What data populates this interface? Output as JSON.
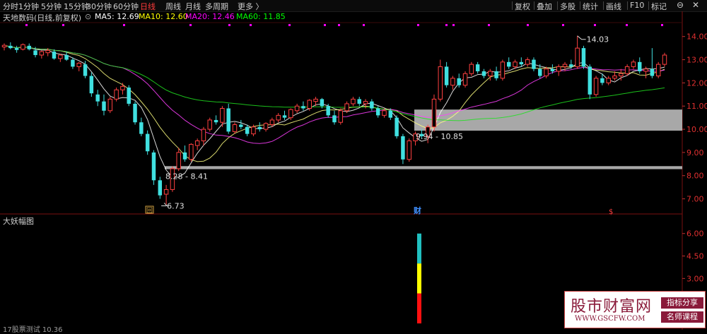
{
  "toolbar": {
    "periods": [
      {
        "label": "分时",
        "active": false
      },
      {
        "label": "1分钟",
        "active": false
      },
      {
        "label": "5分钟",
        "active": false
      },
      {
        "label": "15分钟",
        "active": false
      },
      {
        "label": "30分钟",
        "active": false
      },
      {
        "label": "60分钟",
        "active": false
      },
      {
        "label": "日线",
        "active": true
      },
      {
        "label": "周线",
        "active": false
      },
      {
        "label": "月线",
        "active": false
      },
      {
        "label": "多周期",
        "active": false
      },
      {
        "label": "更多 〉",
        "active": false
      }
    ],
    "right_buttons": [
      "复权",
      "叠加",
      "多股",
      "统计",
      "画线",
      "F10",
      "标记"
    ],
    "window_buttons": [
      "⊖",
      "✕"
    ]
  },
  "infobar": {
    "title": "天地数码(日线,前复权)",
    "ma5": "MA5: 12.69",
    "ma10": "MA10: 12.60",
    "ma20": "MA20: 12.46",
    "ma60": "MA60: 11.85",
    "colors": {
      "ma5": "#ffffff",
      "ma10": "#ffff00",
      "ma20": "#ff00ff",
      "ma60": "#00ff00"
    }
  },
  "annotations": {
    "high": "14.03",
    "low": "6.73",
    "zone_low": "8.28 - 8.41",
    "zone_high": "9.94 - 10.85",
    "fin_marker": "财",
    "buy_marker": "回"
  },
  "price_axis": [
    "14.00",
    "13.00",
    "12.00",
    "11.00",
    "10.00",
    "9.00",
    "8.00",
    "7.00"
  ],
  "sub_axis": [
    "6.00",
    "4.50",
    "3.00"
  ],
  "sub_panel": {
    "title": "大妖幅图"
  },
  "bottom_text": "17股票测试  10.36",
  "watermark": {
    "big": "股市财富网",
    "url": "WWW.GSCFW.COM",
    "tag1": "指标分享",
    "tag2": "名师课程"
  },
  "chart_data": {
    "type": "candlestick",
    "y_range": [
      6.5,
      14.6
    ],
    "candles": [
      [
        13.55,
        13.7,
        13.4,
        13.62
      ],
      [
        13.6,
        13.75,
        13.45,
        13.5
      ],
      [
        13.5,
        13.6,
        13.3,
        13.42
      ],
      [
        13.45,
        13.7,
        13.4,
        13.65
      ],
      [
        13.6,
        13.7,
        13.4,
        13.45
      ],
      [
        13.4,
        13.55,
        13.1,
        13.2
      ],
      [
        13.2,
        13.4,
        13.05,
        13.35
      ],
      [
        13.3,
        13.5,
        13.15,
        13.4
      ],
      [
        13.35,
        13.45,
        13.0,
        13.05
      ],
      [
        13.05,
        13.25,
        12.9,
        13.2
      ],
      [
        13.2,
        13.35,
        12.95,
        13.0
      ],
      [
        13.0,
        13.1,
        12.6,
        12.7
      ],
      [
        12.7,
        12.9,
        12.5,
        12.85
      ],
      [
        12.8,
        12.95,
        12.2,
        12.3
      ],
      [
        12.3,
        12.45,
        11.4,
        11.55
      ],
      [
        11.5,
        11.7,
        11.0,
        11.2
      ],
      [
        11.2,
        11.5,
        10.6,
        10.8
      ],
      [
        10.8,
        11.4,
        10.7,
        11.3
      ],
      [
        11.3,
        11.8,
        11.2,
        11.7
      ],
      [
        11.7,
        12.0,
        11.5,
        11.85
      ],
      [
        11.8,
        11.9,
        11.0,
        11.1
      ],
      [
        11.1,
        11.2,
        10.2,
        10.3
      ],
      [
        10.3,
        10.5,
        9.7,
        9.8
      ],
      [
        9.8,
        9.95,
        8.9,
        9.05
      ],
      [
        9.0,
        9.1,
        7.6,
        7.8
      ],
      [
        7.8,
        7.95,
        7.0,
        7.15
      ],
      [
        7.2,
        7.6,
        6.73,
        7.4
      ],
      [
        7.4,
        8.4,
        7.3,
        8.3
      ],
      [
        8.3,
        9.2,
        8.2,
        9.0
      ],
      [
        9.0,
        9.3,
        8.6,
        8.7
      ],
      [
        8.7,
        9.4,
        8.6,
        9.35
      ],
      [
        9.3,
        9.6,
        9.1,
        9.5
      ],
      [
        9.5,
        10.1,
        9.3,
        10.0
      ],
      [
        10.0,
        10.5,
        9.9,
        10.4
      ],
      [
        10.4,
        10.6,
        10.2,
        10.3
      ],
      [
        10.3,
        11.0,
        10.1,
        10.9
      ],
      [
        10.9,
        11.1,
        9.8,
        9.9
      ],
      [
        9.9,
        10.3,
        9.8,
        10.2
      ],
      [
        10.2,
        10.4,
        10.0,
        10.1
      ],
      [
        10.1,
        10.2,
        9.7,
        9.8
      ],
      [
        9.8,
        10.2,
        9.7,
        10.1
      ],
      [
        10.1,
        10.3,
        9.9,
        10.0
      ],
      [
        10.0,
        10.3,
        9.9,
        10.25
      ],
      [
        10.2,
        10.5,
        10.1,
        10.4
      ],
      [
        10.4,
        10.7,
        10.3,
        10.6
      ],
      [
        10.6,
        10.8,
        10.4,
        10.5
      ],
      [
        10.5,
        10.9,
        10.4,
        10.85
      ],
      [
        10.8,
        11.1,
        10.7,
        11.0
      ],
      [
        11.0,
        11.2,
        10.8,
        10.9
      ],
      [
        10.9,
        11.3,
        10.8,
        11.25
      ],
      [
        11.2,
        11.4,
        11.0,
        11.3
      ],
      [
        11.3,
        11.35,
        10.9,
        11.0
      ],
      [
        11.0,
        11.1,
        10.5,
        10.6
      ],
      [
        10.6,
        10.8,
        10.2,
        10.3
      ],
      [
        10.3,
        10.9,
        10.2,
        10.8
      ],
      [
        10.8,
        11.2,
        10.7,
        11.1
      ],
      [
        11.1,
        11.4,
        11.0,
        11.3
      ],
      [
        11.3,
        11.4,
        11.0,
        11.1
      ],
      [
        11.1,
        11.3,
        10.9,
        11.2
      ],
      [
        11.2,
        11.3,
        10.8,
        10.9
      ],
      [
        10.9,
        11.0,
        10.5,
        10.6
      ],
      [
        10.6,
        10.9,
        10.5,
        10.8
      ],
      [
        10.8,
        10.9,
        10.4,
        10.5
      ],
      [
        10.5,
        10.6,
        9.6,
        9.7
      ],
      [
        9.7,
        9.8,
        8.5,
        8.7
      ],
      [
        8.7,
        9.6,
        8.6,
        9.5
      ],
      [
        9.5,
        9.9,
        9.3,
        9.8
      ],
      [
        9.8,
        10.0,
        9.6,
        9.7
      ],
      [
        9.7,
        10.2,
        9.4,
        10.1
      ],
      [
        10.1,
        11.5,
        9.9,
        11.3
      ],
      [
        11.3,
        13.0,
        11.2,
        12.7
      ],
      [
        12.7,
        12.9,
        11.8,
        11.9
      ],
      [
        11.9,
        12.3,
        11.7,
        12.2
      ],
      [
        12.2,
        12.4,
        11.8,
        11.9
      ],
      [
        11.9,
        12.5,
        11.8,
        12.4
      ],
      [
        12.4,
        12.9,
        12.3,
        12.8
      ],
      [
        12.8,
        12.9,
        12.4,
        12.5
      ],
      [
        12.5,
        12.6,
        12.2,
        12.3
      ],
      [
        12.3,
        12.6,
        12.1,
        12.5
      ],
      [
        12.5,
        12.7,
        12.1,
        12.2
      ],
      [
        12.2,
        13.0,
        12.1,
        12.9
      ],
      [
        12.9,
        13.1,
        12.6,
        12.7
      ],
      [
        12.7,
        13.0,
        12.6,
        12.9
      ],
      [
        12.9,
        13.1,
        12.7,
        12.8
      ],
      [
        12.8,
        13.1,
        12.7,
        13.0
      ],
      [
        13.0,
        13.1,
        12.5,
        12.6
      ],
      [
        12.6,
        12.8,
        12.2,
        12.3
      ],
      [
        12.3,
        12.7,
        12.2,
        12.6
      ],
      [
        12.6,
        12.8,
        12.4,
        12.5
      ],
      [
        12.5,
        12.8,
        12.3,
        12.7
      ],
      [
        12.7,
        12.9,
        12.5,
        12.8
      ],
      [
        12.8,
        13.0,
        12.6,
        12.7
      ],
      [
        12.7,
        14.03,
        12.6,
        13.5
      ],
      [
        13.5,
        13.6,
        12.6,
        12.7
      ],
      [
        12.7,
        12.8,
        11.3,
        11.5
      ],
      [
        11.5,
        12.3,
        11.4,
        12.2
      ],
      [
        12.2,
        12.4,
        11.9,
        12.0
      ],
      [
        12.0,
        12.3,
        11.9,
        12.2
      ],
      [
        12.2,
        12.5,
        12.1,
        12.3
      ],
      [
        12.3,
        12.6,
        12.1,
        12.4
      ],
      [
        12.4,
        12.8,
        12.3,
        12.7
      ],
      [
        12.7,
        13.0,
        12.6,
        12.9
      ],
      [
        12.9,
        13.1,
        12.4,
        12.5
      ],
      [
        12.5,
        12.7,
        12.2,
        12.6
      ],
      [
        12.6,
        13.5,
        12.2,
        12.3
      ],
      [
        12.3,
        12.9,
        12.2,
        12.8
      ],
      [
        12.8,
        13.3,
        12.7,
        13.2
      ]
    ]
  }
}
